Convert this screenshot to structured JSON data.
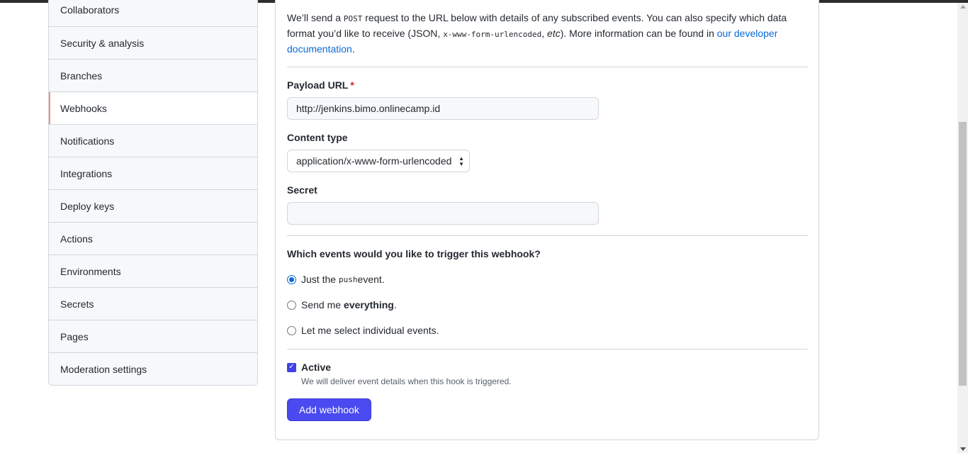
{
  "sidebar": {
    "items": [
      {
        "label": "Collaborators",
        "selected": false
      },
      {
        "label": "Security & analysis",
        "selected": false
      },
      {
        "label": "Branches",
        "selected": false
      },
      {
        "label": "Webhooks",
        "selected": true
      },
      {
        "label": "Notifications",
        "selected": false
      },
      {
        "label": "Integrations",
        "selected": false
      },
      {
        "label": "Deploy keys",
        "selected": false
      },
      {
        "label": "Actions",
        "selected": false
      },
      {
        "label": "Environments",
        "selected": false
      },
      {
        "label": "Secrets",
        "selected": false
      },
      {
        "label": "Pages",
        "selected": false
      },
      {
        "label": "Moderation settings",
        "selected": false
      }
    ]
  },
  "intro": {
    "part1": "We’ll send a ",
    "code1": "POST",
    "part2": " request to the URL below with details of any subscribed events. You can also specify which data format you’d like to receive (JSON, ",
    "code2": "x-www-form-urlencoded",
    "part3": ", ",
    "etc": "etc",
    "part4": "). More information can be found in ",
    "link": "our developer documentation",
    "part5": "."
  },
  "payload": {
    "label": "Payload URL",
    "required_mark": "*",
    "value": "http://jenkins.bimo.onlinecamp.id"
  },
  "content_type": {
    "label": "Content type",
    "selected": "application/x-www-form-urlencoded",
    "arrows_up": "▲",
    "arrows_down": "▼"
  },
  "secret": {
    "label": "Secret",
    "value": ""
  },
  "events": {
    "heading": "Which events would you like to trigger this webhook?",
    "options": [
      {
        "prefix": "Just the ",
        "code": "push",
        "suffix": " event.",
        "checked": true
      },
      {
        "prefix": "Send me ",
        "bold": "everything",
        "suffix": ".",
        "checked": false
      },
      {
        "text": "Let me select individual events.",
        "checked": false
      }
    ]
  },
  "active": {
    "label": "Active",
    "checked": true,
    "checkmark": "✓",
    "note": "We will deliver event details when this hook is triggered."
  },
  "submit": {
    "label": "Add webhook"
  },
  "colors": {
    "accent": "#0969da",
    "button": "#4a4af0",
    "selected_indicator": "#fd8c73",
    "border": "#d0d7de"
  }
}
